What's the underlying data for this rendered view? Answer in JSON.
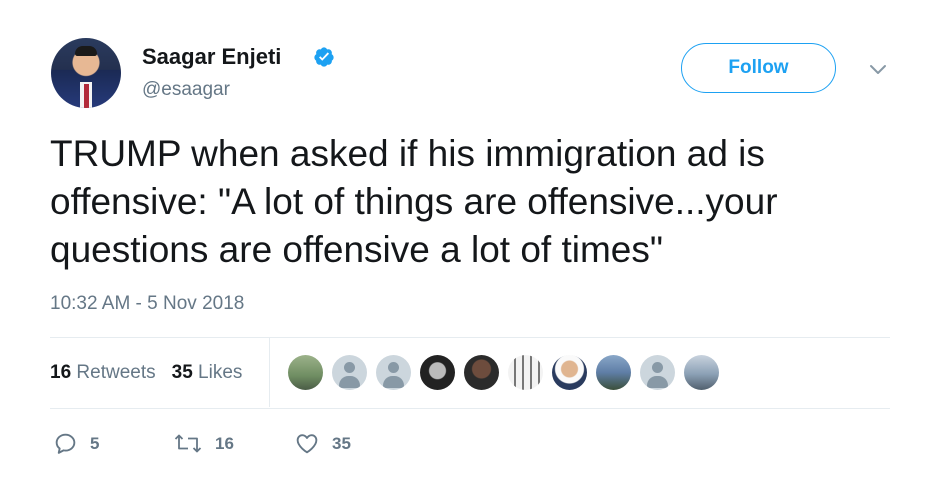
{
  "author": {
    "name": "Saagar Enjeti",
    "handle": "@esaagar",
    "verified": true
  },
  "follow_button": {
    "label": "Follow"
  },
  "tweet": {
    "text": "TRUMP when asked if his immigration ad is offensive: \"A lot of things are offensive...your questions are offensive a lot of times\"",
    "timestamp": "10:32 AM - 5 Nov 2018"
  },
  "stats": {
    "retweets_count": "16",
    "retweets_label": "Retweets",
    "likes_count": "35",
    "likes_label": "Likes"
  },
  "actions": {
    "reply_count": "5",
    "retweet_count": "16",
    "like_count": "35"
  },
  "icons": {
    "verified": "verified-badge-icon",
    "caret": "chevron-down-icon",
    "reply": "reply-icon",
    "retweet": "retweet-icon",
    "like": "heart-icon"
  },
  "colors": {
    "accent": "#1da1f2",
    "text": "#14171a",
    "muted": "#657786",
    "divider": "#e6ecf0"
  }
}
